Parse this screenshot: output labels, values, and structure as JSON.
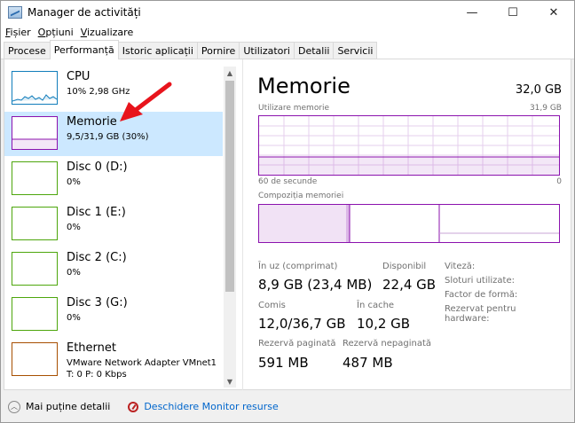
{
  "window": {
    "title": "Manager de activități",
    "minimize": "—",
    "maximize": "☐",
    "close": "✕"
  },
  "menu": [
    {
      "label": "Fișier",
      "accel": "F"
    },
    {
      "label": "Opțiuni",
      "accel": "O"
    },
    {
      "label": "Vizualizare",
      "accel": "V"
    }
  ],
  "tabs": [
    "Procese",
    "Performanță",
    "Istoric aplicații",
    "Pornire",
    "Utilizatori",
    "Detalii",
    "Servicii"
  ],
  "active_tab": 1,
  "sidebar": {
    "items": [
      {
        "name": "CPU",
        "sub": "10%  2,98 GHz",
        "sub2": "",
        "color": "#117dbb"
      },
      {
        "name": "Memorie",
        "sub": "9,5/31,9 GB (30%)",
        "sub2": "",
        "color": "#8b12ae"
      },
      {
        "name": "Disc 0 (D:)",
        "sub": "0%",
        "sub2": "",
        "color": "#4da60c"
      },
      {
        "name": "Disc 1 (E:)",
        "sub": "0%",
        "sub2": "",
        "color": "#4da60c"
      },
      {
        "name": "Disc 2 (C:)",
        "sub": "0%",
        "sub2": "",
        "color": "#4da60c"
      },
      {
        "name": "Disc 3 (G:)",
        "sub": "0%",
        "sub2": "",
        "color": "#4da60c"
      },
      {
        "name": "Ethernet",
        "sub": "VMware Network Adapter VMnet1",
        "sub2": "T: 0 P: 0 Kbps",
        "color": "#a74f01"
      }
    ],
    "selected": 1,
    "scroll_up": "▲",
    "scroll_down": "▼"
  },
  "main": {
    "title": "Memorie",
    "total": "32,0 GB",
    "usage_label": "Utilizare memorie",
    "usage_max": "31,9 GB",
    "time_left": "60 de secunde",
    "time_right": "0",
    "composition_label": "Compoziția memoriei",
    "stats": {
      "in_use_label": "În uz (comprimat)",
      "in_use_value": "8,9 GB (23,4 MB)",
      "available_label": "Disponibil",
      "available_value": "22,4 GB",
      "committed_label": "Comis",
      "committed_value": "12,0/36,7 GB",
      "cached_label": "În cache",
      "cached_value": "10,2 GB",
      "paged_label": "Rezervă paginată",
      "paged_value": "591 MB",
      "nonpaged_label": "Rezervă nepaginată",
      "nonpaged_value": "487 MB"
    },
    "right_labels": [
      "Viteză:",
      "Sloturi utilizate:",
      "Factor de formă:",
      "Rezervat pentru hardware:"
    ]
  },
  "bottom": {
    "fewer_details": "Mai puține detalii",
    "resource_monitor": "Deschidere Monitor resurse"
  },
  "colors": {
    "memory": "#8b12ae",
    "cpu": "#117dbb",
    "disk": "#4da60c",
    "ethernet": "#a74f01",
    "selection": "#cce8ff",
    "arrow": "#e8141c"
  }
}
